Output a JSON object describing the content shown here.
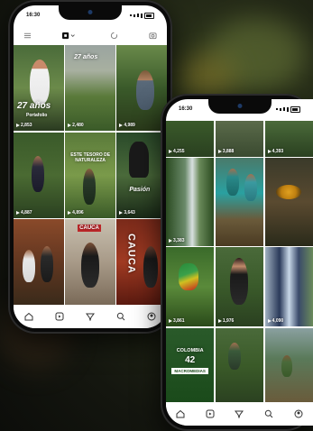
{
  "phone_left": {
    "time": "16:30",
    "tiles": [
      {
        "views": "2,853",
        "text": "27 años",
        "sub": "Portafolio"
      },
      {
        "views": "2,480",
        "text": "27 años"
      },
      {
        "views": "4,989",
        "text": ""
      },
      {
        "views": "4,887",
        "text": "ESTE TESORO DE NATURALEZA"
      },
      {
        "views": "4,896",
        "text": ""
      },
      {
        "views": "3,643",
        "text": "Pasión"
      },
      {
        "views": "",
        "text": ""
      },
      {
        "views": "",
        "text": "CAUCA"
      },
      {
        "views": "",
        "text": "CAUCA"
      }
    ]
  },
  "phone_right": {
    "time": "16:30",
    "tiles": [
      {
        "views": "4,255",
        "text": ""
      },
      {
        "views": "3,888",
        "text": ""
      },
      {
        "views": "4,393",
        "text": ""
      },
      {
        "views": "3,383",
        "text": ""
      },
      {
        "views": "",
        "text": ""
      },
      {
        "views": "",
        "text": ""
      },
      {
        "views": "3,861",
        "text": ""
      },
      {
        "views": "1,976",
        "text": ""
      },
      {
        "views": "4,090",
        "text": ""
      },
      {
        "views": "",
        "text": "COLOMBIA"
      },
      {
        "views": "",
        "text": ""
      },
      {
        "views": "",
        "text": ""
      }
    ],
    "colombia_banner": {
      "line1": "COLOMBIA",
      "line2": "42",
      "line3": "MACROMEDIAS"
    }
  },
  "icons": [
    "home-icon",
    "reels-icon",
    "explore-icon",
    "search-icon",
    "profile-icon"
  ]
}
